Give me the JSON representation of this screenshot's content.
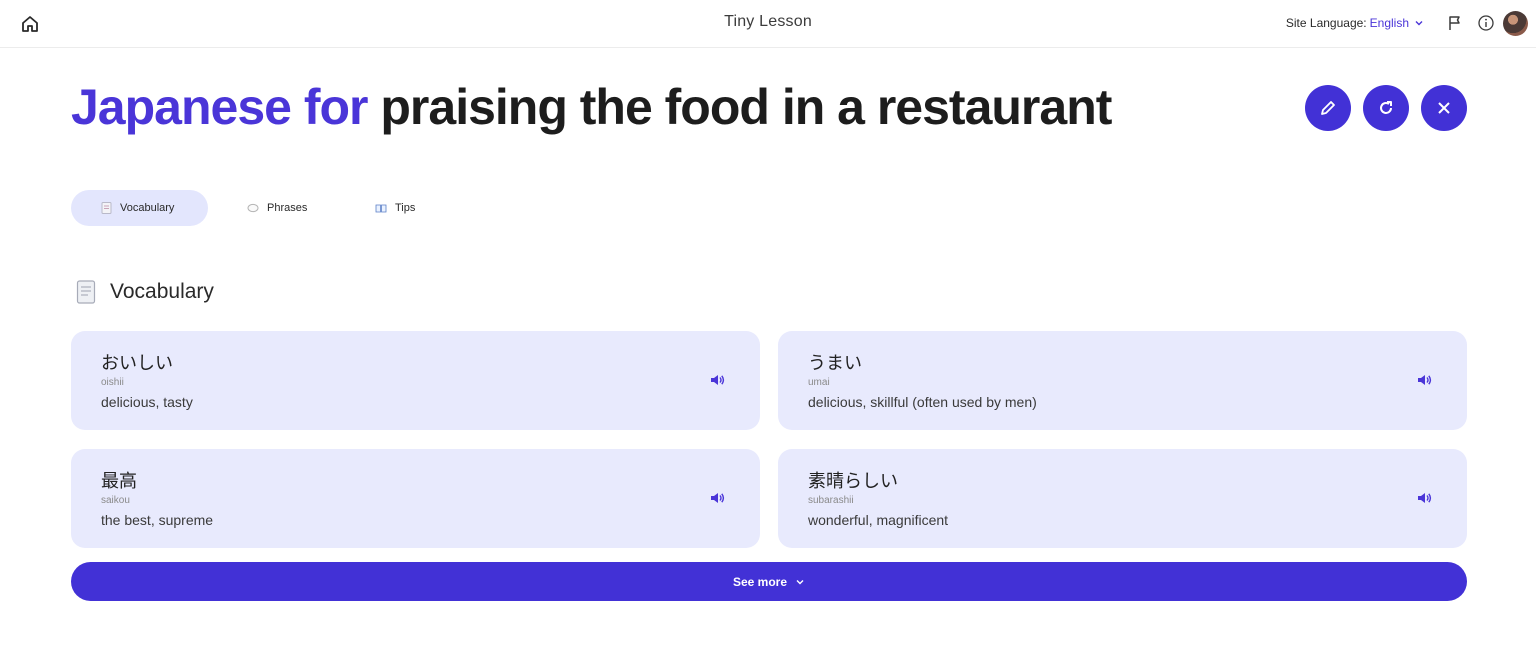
{
  "header": {
    "app_title": "Tiny Lesson",
    "site_language_label": "Site Language:",
    "site_language_value": "English"
  },
  "lesson": {
    "title_language": "Japanese for",
    "title_topic": "praising the food in a restaurant"
  },
  "tabs": [
    {
      "label": "Vocabulary",
      "icon": "memo-icon",
      "active": true
    },
    {
      "label": "Phrases",
      "icon": "speech-bubble-icon",
      "active": false
    },
    {
      "label": "Tips",
      "icon": "open-book-icon",
      "active": false
    }
  ],
  "section": {
    "title": "Vocabulary",
    "icon": "memo-icon"
  },
  "vocabulary": [
    {
      "word": "おいしい",
      "romaji": "oishii",
      "meaning": "delicious, tasty"
    },
    {
      "word": "うまい",
      "romaji": "umai",
      "meaning": "delicious, skillful (often used by men)"
    },
    {
      "word": "最高",
      "romaji": "saikou",
      "meaning": "the best, supreme"
    },
    {
      "word": "素晴らしい",
      "romaji": "subarashii",
      "meaning": "wonderful, magnificent"
    }
  ],
  "see_more_label": "See more",
  "colors": {
    "accent": "#4231d6",
    "card_bg": "#e8eafd",
    "tab_active_bg": "#e3e6fd"
  }
}
